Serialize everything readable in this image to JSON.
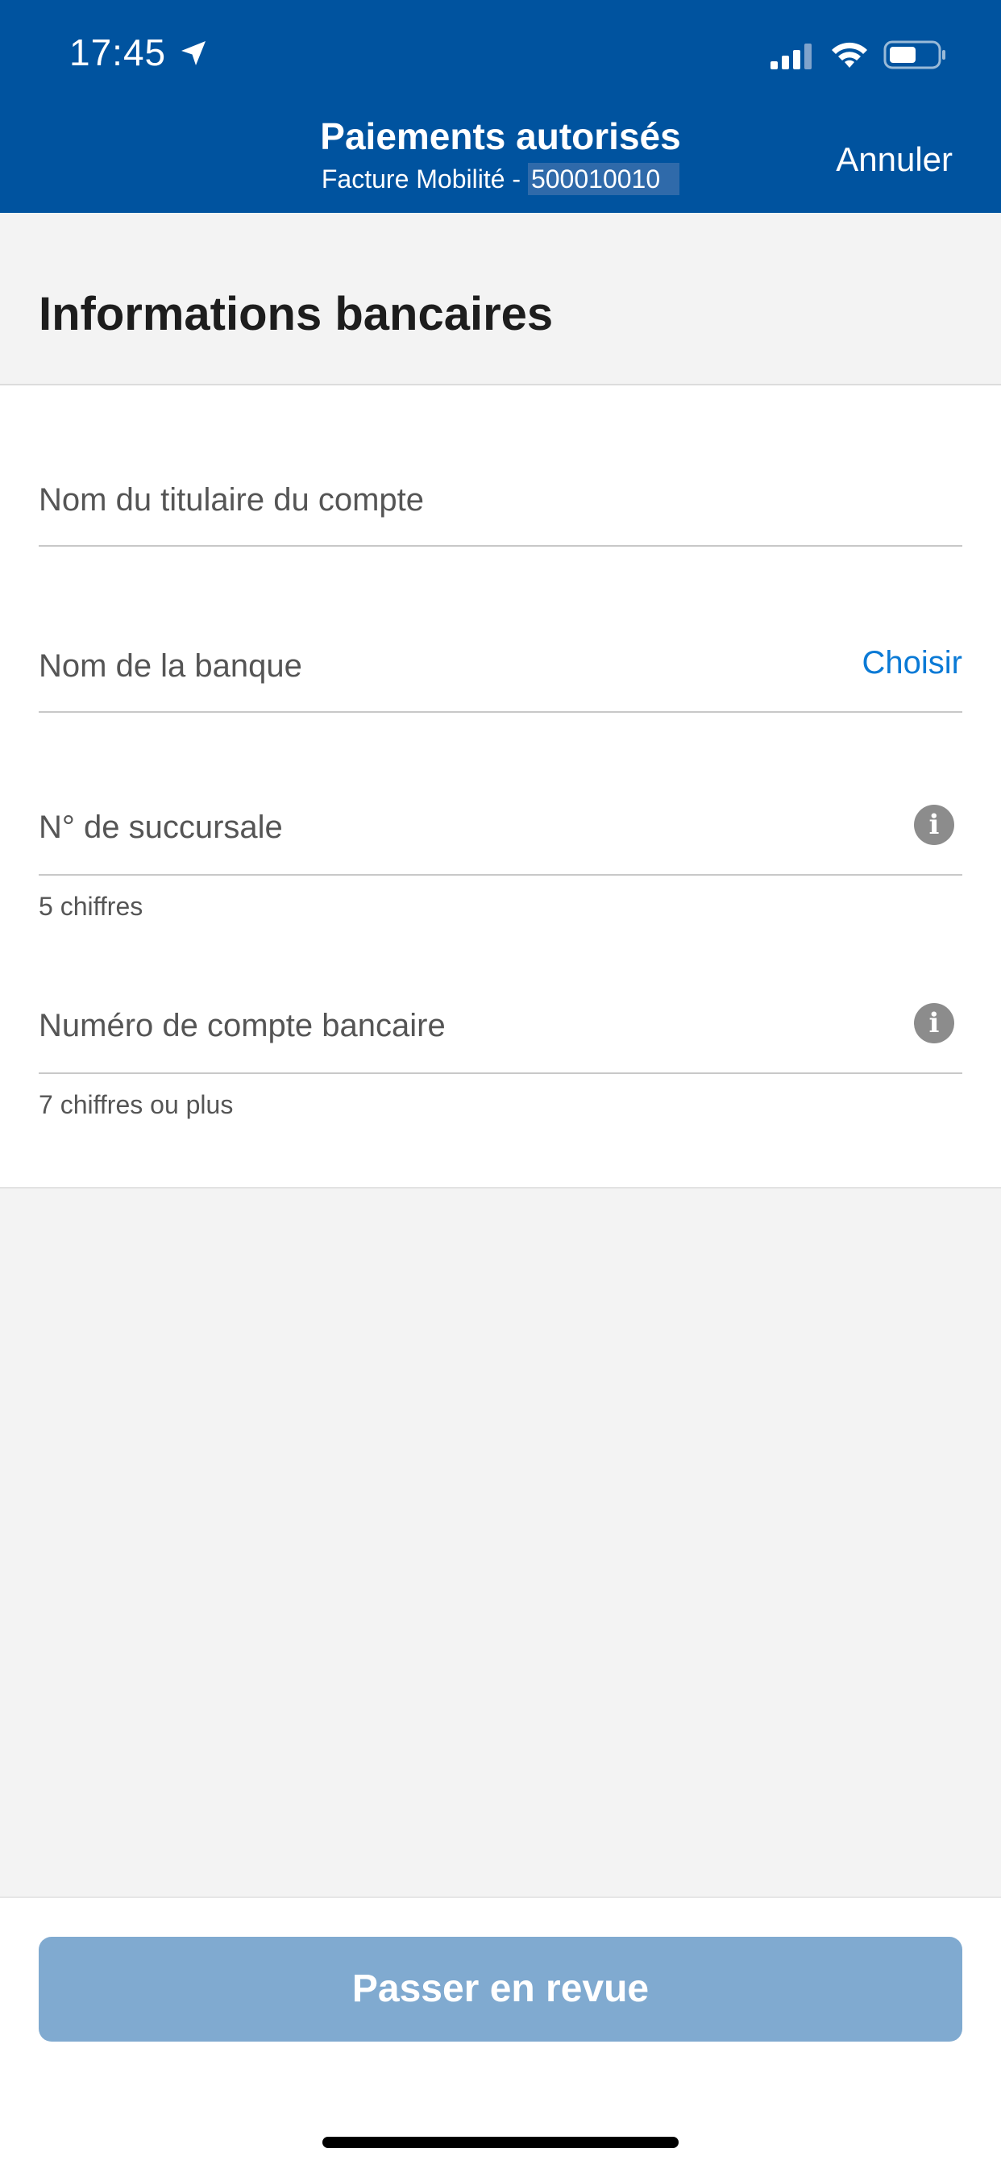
{
  "status": {
    "time": "17:45"
  },
  "header": {
    "title": "Paiements autorisés",
    "subtitle_prefix": "Facture Mobilité - ",
    "account_number": "500010010",
    "cancel_label": "Annuler"
  },
  "section": {
    "title": "Informations bancaires"
  },
  "form": {
    "holder_placeholder": "Nom du titulaire du compte",
    "bank_placeholder": "Nom de la banque",
    "bank_action": "Choisir",
    "branch_placeholder": "N° de succursale",
    "branch_hint": "5 chiffres",
    "account_placeholder": "Numéro de compte bancaire",
    "account_hint": "7 chiffres ou plus",
    "info_glyph": "i"
  },
  "footer": {
    "review_label": "Passer en revue"
  },
  "colors": {
    "header": "#00539f",
    "link": "#0a7ad6",
    "button_disabled": "#80aad0"
  }
}
